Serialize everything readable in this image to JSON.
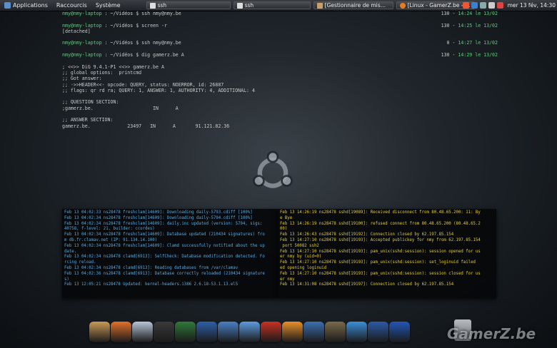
{
  "top_panel": {
    "menus": [
      "Applications",
      "Raccourcis",
      "Système"
    ],
    "tasks": [
      {
        "label": "ssh",
        "icon": "terminal-icon"
      },
      {
        "label": "ssh",
        "icon": "terminal-icon"
      },
      {
        "label": "[Gestionnaire de mis…",
        "icon": "package-manager-icon"
      },
      {
        "label": "[Linux - GamerZ.be - …",
        "icon": "firefox-icon"
      }
    ],
    "clock": "mer 13 fév, 14:30"
  },
  "terminal": {
    "history": [
      {
        "prompt": "nmy@nmy-laptop",
        "path": "~/Vidéos",
        "command": "ssh nmy@nmy.be",
        "num": "130",
        "time": "14:24 le 13/02"
      },
      {
        "prompt": "nmy@nmy-laptop",
        "path": "~/Vidéos",
        "command": "screen -r",
        "num": "130",
        "time": "14:25 le 13/02"
      },
      {
        "output": "[detached]"
      },
      {
        "prompt": "nmy@nmy-laptop",
        "path": "~/Vidéos",
        "command": "ssh nmy@nmy.be",
        "num": "0",
        "time": "14:27 le 13/02"
      },
      {
        "prompt": "nmy@nmy-laptop",
        "path": "~/Vidéos",
        "command": "dig gamerz.be A",
        "num": "130",
        "time": "14:29 le 13/02"
      }
    ],
    "dig_output": [
      "; <<>> DiG 9.4.1-P1 <<>> gamerz.be A",
      ";; global options:  printcmd",
      ";; Got answer:",
      ";; ->>HEADER<<- opcode: QUERY, status: NOERROR, id: 26887",
      ";; flags: qr rd ra; QUERY: 1, ANSWER: 1, AUTHORITY: 4, ADDITIONAL: 4",
      "",
      ";; QUESTION SECTION:",
      ";gamerz.be.                     IN      A",
      "",
      ";; ANSWER SECTION:",
      "gamerz.be.             23497   IN      A       91.121.82.36"
    ]
  },
  "log_left": [
    "Feb 13 04:02:33 ns28478 freshclam[14609]: Downloading daily-5793.cdiff [100%]",
    "Feb 13 04:02:34 ns28478 freshclam[14609]: Downloading daily-5794.cdiff [100%]",
    "Feb 13 04:02:34 ns28478 freshclam[14609]: daily.inc updated (version: 5794, sigs:",
    "40758, f-level: 21, builder: ccordes)",
    "Feb 13 04:02:34 ns28478 freshclam[14609]: Database updated (210434 signatures) fro",
    "m db.fr.clamav.net (IP: 91.134.14.100)",
    "Feb 13 04:02:34 ns28478 freshclam[14609]: Clamd successfully notified about the up",
    "date.",
    "Feb 13 04:02:34 ns28478 clamd[6913]: SelfCheck: Database modification detected. Fo",
    "rcing reload.",
    "Feb 13 04:02:34 ns28478 clamd[6913]: Reading databases from /var/clamav",
    "Feb 13 04:02:36 ns28478 clamd[6913]: Database correctly reloaded (210434 signature",
    "s)",
    "Feb 13 12:05:21 ns28478 Updated: kernel-headers.i386 2.6.18-53.1.13.el5"
  ],
  "log_right": [
    "Feb 13 14:26:19 ns28478 sshd[19089]: Received disconnect from 80.48.65.200: 11: By",
    "e Bye",
    "Feb 13 14:26:19 ns28478 sshd[19100]: refused connect from 80.48.65.200 (80.48.65.2",
    "00)",
    "Feb 13 14:26:43 ns28478 sshd[19192]: Connection closed by 62.197.85.154",
    "Feb 13 14:27:10 ns28478 sshd[19193]: Accepted publickey for nmy from 62.197.85.154",
    " port 50082 ssh2",
    "Feb 13 14:27:10 ns28478 sshd[19193]: pam_unix(sshd:session): session opened for us",
    "er nmy by (uid=0)",
    "Feb 13 14:27:10 ns28478 sshd[19193]: pam_unix(sshd:session): set_loginuid failed",
    "ed opening loginuid",
    "Feb 13 14:27:10 ns28478 sshd[19193]: pam_unix(sshd:session): session closed for us",
    "er nmy",
    "Feb 13 14:31:08 ns28478 sshd[19197]: Connection closed by 62.197.85.154"
  ],
  "dock_icons": [
    "package-icon",
    "firefox-icon",
    "pidgin-icon",
    "clapper-icon",
    "compass-icon",
    "lock-icon",
    "bluetooth-icon",
    "people-icon",
    "filezilla-icon",
    "vlc-icon",
    "music-icon",
    "gimp-icon",
    "network-icon",
    "word-icon",
    "app-icon"
  ],
  "brand_text": "GamerZ.be",
  "colors": {
    "prompt_green": "#5ccf7a",
    "log_blue": "#59aadf",
    "log_yellow": "#e2cb38"
  }
}
